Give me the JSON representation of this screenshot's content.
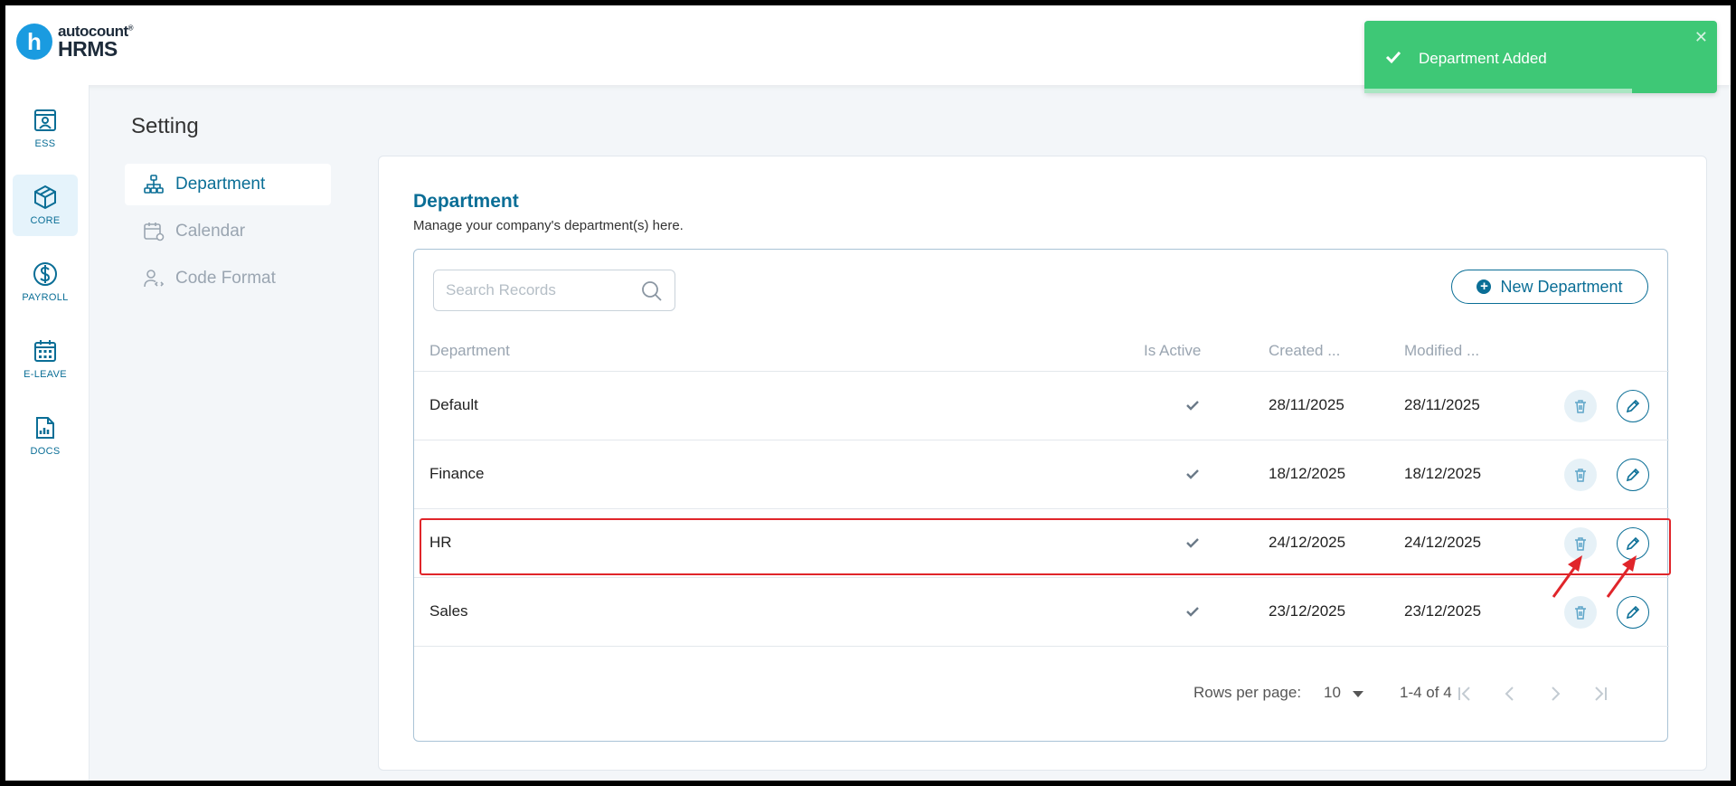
{
  "app": {
    "logo_letter": "h",
    "logo_top": "autocount",
    "logo_reg": "®",
    "logo_bottom": "HRMS"
  },
  "sidenav": [
    {
      "label": "ESS",
      "icon": "ess-icon",
      "active": false
    },
    {
      "label": "CORE",
      "icon": "core-icon",
      "active": true
    },
    {
      "label": "PAYROLL",
      "icon": "payroll-icon",
      "active": false
    },
    {
      "label": "E-LEAVE",
      "icon": "calendar-grid-icon",
      "active": false
    },
    {
      "label": "DOCS",
      "icon": "docs-icon",
      "active": false
    }
  ],
  "page": {
    "title": "Setting"
  },
  "settings_menu": [
    {
      "label": "Department",
      "icon": "org-chart-icon",
      "active": true
    },
    {
      "label": "Calendar",
      "icon": "calendar-settings-icon",
      "active": false
    },
    {
      "label": "Code Format",
      "icon": "code-user-icon",
      "active": false
    }
  ],
  "panel": {
    "title": "Department",
    "subtitle": "Manage your company's department(s) here.",
    "search_placeholder": "Search Records",
    "new_button": "New Department"
  },
  "table": {
    "columns": [
      "Department",
      "Is Active",
      "Created ...",
      "Modified ..."
    ],
    "rows": [
      {
        "department": "Default",
        "is_active": true,
        "created": "28/11/2025",
        "modified": "28/11/2025"
      },
      {
        "department": "Finance",
        "is_active": true,
        "created": "18/12/2025",
        "modified": "18/12/2025"
      },
      {
        "department": "HR",
        "is_active": true,
        "created": "24/12/2025",
        "modified": "24/12/2025",
        "highlighted": true
      },
      {
        "department": "Sales",
        "is_active": true,
        "created": "23/12/2025",
        "modified": "23/12/2025"
      }
    ]
  },
  "pagination": {
    "rows_per_page_label": "Rows per page:",
    "rows_per_page": "10",
    "range": "1-4 of 4"
  },
  "toast": {
    "message": "Department Added",
    "close": "✕",
    "progress": 0.76
  },
  "colors": {
    "accent": "#0a6e96",
    "toast_bg": "#3ec876",
    "highlight": "#e0252a"
  }
}
